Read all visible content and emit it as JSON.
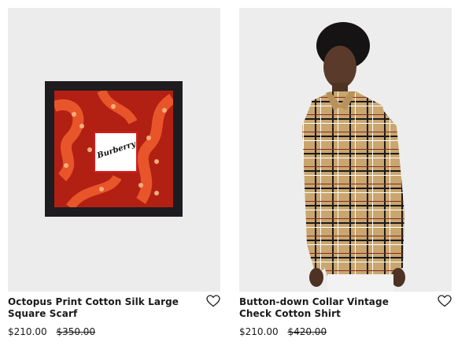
{
  "products": [
    {
      "title": "Octopus Print Cotton Silk Large Square Scarf",
      "price": "$210.00",
      "original_price": "$350.00",
      "image_logo_text": "Burberry",
      "wishlist_icon": "heart-outline-icon"
    },
    {
      "title": "Button-down Collar Vintage Check Cotton Shirt",
      "price": "$210.00",
      "original_price": "$420.00",
      "wishlist_icon": "heart-outline-icon"
    }
  ],
  "colors": {
    "text": "#1a1a1a",
    "image_bg": "#ededed",
    "scarf_red": "#b22014",
    "shirt_tan": "#c9a66e"
  }
}
